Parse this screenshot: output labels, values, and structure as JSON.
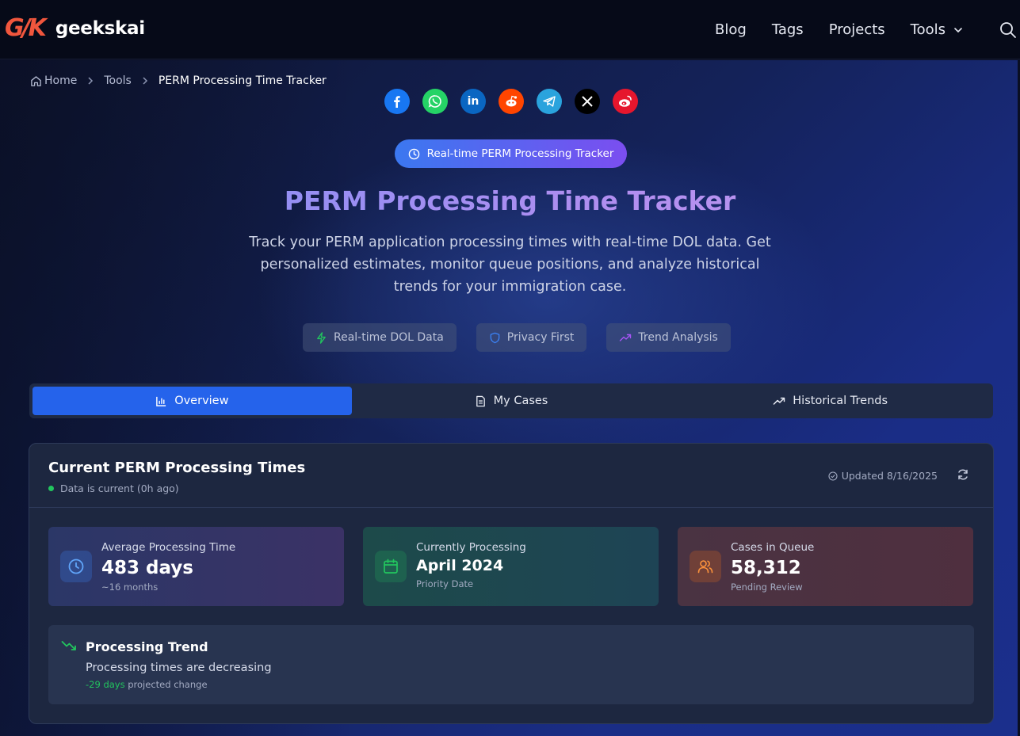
{
  "navbar": {
    "logo_mark": "G/K",
    "brand": "geekskai",
    "links": [
      "Blog",
      "Tags",
      "Projects",
      "Tools"
    ]
  },
  "breadcrumb": {
    "home": "Home",
    "tools": "Tools",
    "current": "PERM Processing Time Tracker"
  },
  "share": [
    {
      "name": "facebook",
      "glyph": "f",
      "color": "#1877f2"
    },
    {
      "name": "whatsapp",
      "glyph": "",
      "color": "#25d366"
    },
    {
      "name": "linkedin",
      "glyph": "in",
      "color": "#0a66c2"
    },
    {
      "name": "reddit",
      "glyph": "",
      "color": "#ff4500"
    },
    {
      "name": "telegram",
      "glyph": "",
      "color": "#2aa3dd"
    },
    {
      "name": "x",
      "glyph": "X",
      "color": "#000000"
    },
    {
      "name": "weibo",
      "glyph": "",
      "color": "#e6162d"
    }
  ],
  "hero": {
    "pill": "Real-time PERM Processing Tracker",
    "title": "PERM Processing Time Tracker",
    "description": "Track your PERM application processing times with real-time DOL data. Get personalized estimates, monitor queue positions, and analyze historical trends for your immigration case.",
    "badges": [
      "Real-time DOL Data",
      "Privacy First",
      "Trend Analysis"
    ]
  },
  "tabs": [
    "Overview",
    "My Cases",
    "Historical Trends"
  ],
  "card": {
    "title": "Current PERM Processing Times",
    "status": "Data is current (0h ago)",
    "updated": "Updated 8/16/2025",
    "stats": [
      {
        "label": "Average Processing Time",
        "value": "483 days",
        "sub": "~16 months"
      },
      {
        "label": "Currently Processing",
        "value": "April 2024",
        "sub": "Priority Date"
      },
      {
        "label": "Cases in Queue",
        "value": "58,312",
        "sub": "Pending Review"
      }
    ],
    "trend": {
      "title": "Processing Trend",
      "description": "Processing times are decreasing",
      "change_value": "-29 days",
      "change_label": " projected change"
    }
  }
}
